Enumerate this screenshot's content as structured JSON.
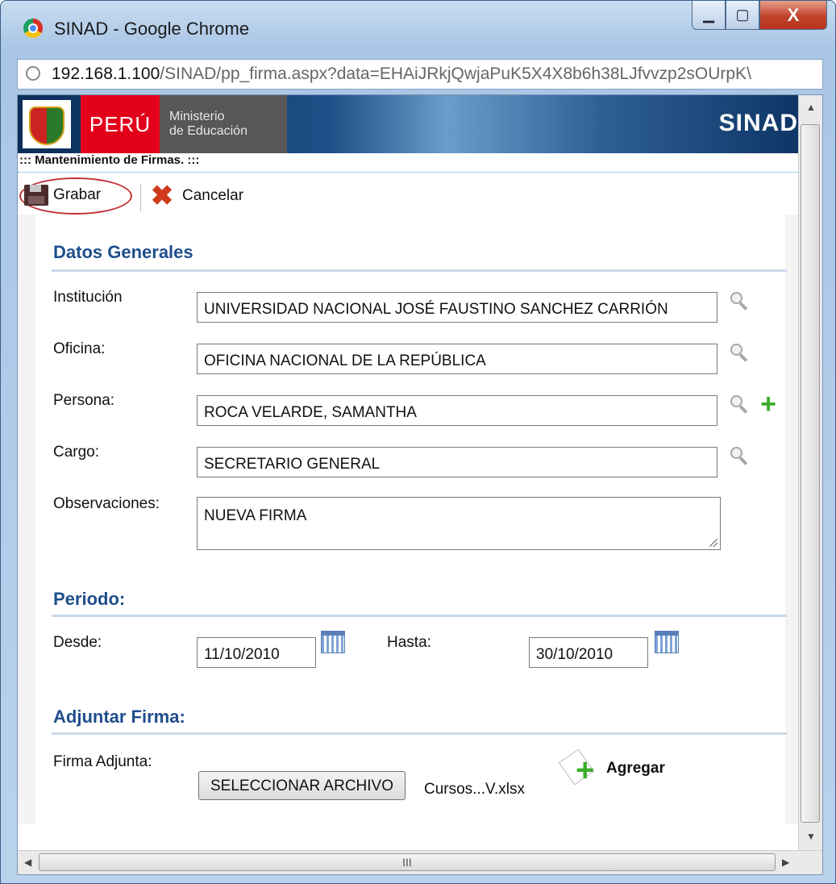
{
  "window": {
    "title": "SINAD - Google Chrome",
    "buttons": {
      "minimize": "▁",
      "maximize": "▢",
      "close": "X"
    }
  },
  "address": {
    "host": "192.168.1.100",
    "path": "/SINAD/pp_firma.aspx?data=EHAiJRkjQwjaPuK5X4X8b6h38LJfvvzp2sOUrpK\\"
  },
  "header": {
    "country": "PERÚ",
    "ministry_line1": "Ministerio",
    "ministry_line2": "de Educación",
    "system": "SINAD"
  },
  "page_title": "::: Mantenimiento de Firmas. :::",
  "toolbar": {
    "save_label": "Grabar",
    "cancel_label": "Cancelar"
  },
  "sections": {
    "general": "Datos Generales",
    "period": "Periodo:",
    "attach": "Adjuntar Firma:"
  },
  "form": {
    "institucion": {
      "label": "Institución",
      "value": "UNIVERSIDAD NACIONAL JOSÉ FAUSTINO SANCHEZ CARRIÓN"
    },
    "oficina": {
      "label": "Oficina:",
      "value": "OFICINA NACIONAL DE LA REPÚBLICA"
    },
    "persona": {
      "label": "Persona:",
      "value": "ROCA VELARDE, SAMANTHA"
    },
    "cargo": {
      "label": "Cargo:",
      "value": "SECRETARIO GENERAL"
    },
    "observaciones": {
      "label": "Observaciones:",
      "value": "NUEVA FIRMA"
    },
    "desde": {
      "label": "Desde:",
      "value": "11/10/2010"
    },
    "hasta": {
      "label": "Hasta:",
      "value": "30/10/2010"
    },
    "firma": {
      "label": "Firma Adjunta:",
      "button": "SELECCIONAR ARCHIVO",
      "file": "Cursos...V.xlsx",
      "add": "Agregar"
    }
  },
  "scroll": {
    "h_thumb_grip": "III"
  }
}
